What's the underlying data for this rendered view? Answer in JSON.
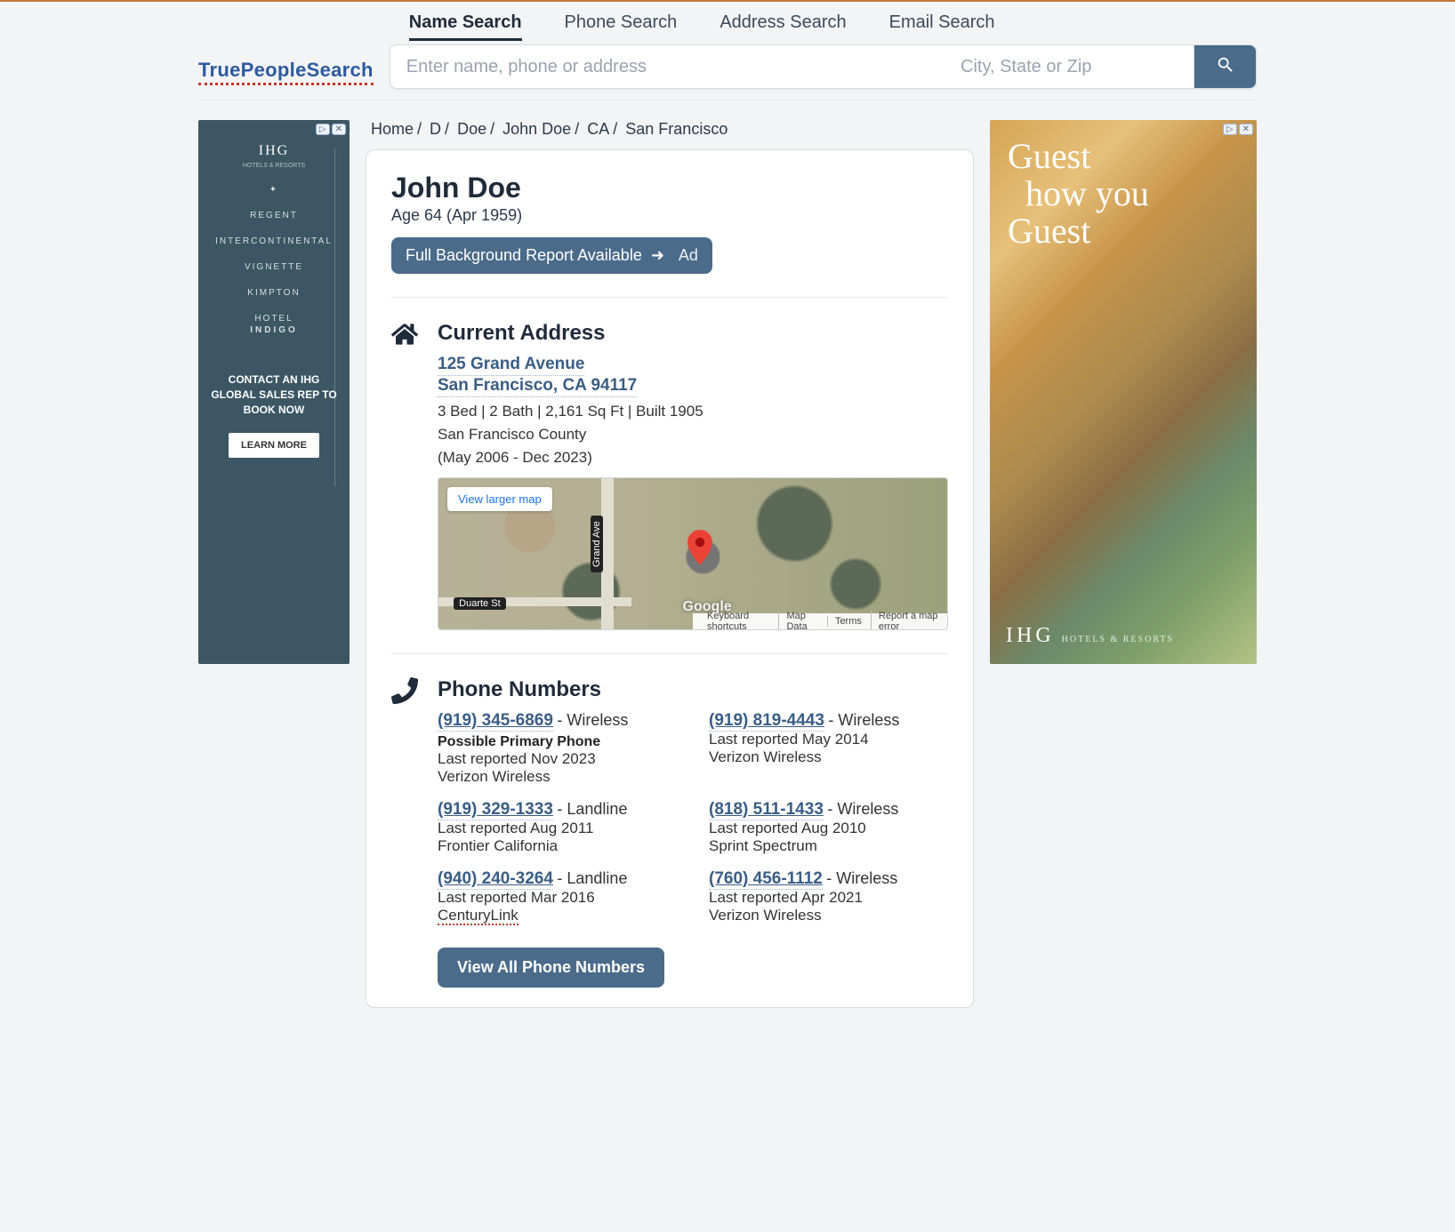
{
  "logo": {
    "part1": "True",
    "part2": "PeopleSearch"
  },
  "tabs": [
    "Name Search",
    "Phone Search",
    "Address Search",
    "Email Search"
  ],
  "search": {
    "name_ph": "Enter name, phone or address",
    "loc_ph": "City, State or Zip"
  },
  "breadcrumbs": [
    "Home",
    "D",
    "Doe",
    "John Doe",
    "CA",
    "San Francisco"
  ],
  "person": {
    "name": "John Doe",
    "age_line": "Age 64 (Apr 1959)"
  },
  "bg_button": {
    "label": "Full Background Report Available",
    "ad": "Ad"
  },
  "address": {
    "title": "Current Address",
    "line1": "125 Grand Avenue",
    "line2": "San Francisco, CA 94117",
    "specs": "3 Bed | 2 Bath | 2,161 Sq Ft | Built 1905",
    "county": "San Francisco County",
    "dates": "(May 2006 - Dec 2023)"
  },
  "map": {
    "view_larger": "View larger map",
    "road_v": "Grand Ave",
    "road_h": "Duarte St",
    "google": "Google",
    "controls": [
      "Keyboard shortcuts",
      "Map Data",
      "Terms",
      "Report a map error"
    ]
  },
  "phones": {
    "title": "Phone Numbers",
    "view_all": "View All Phone Numbers",
    "list": [
      {
        "number": "(919) 345-6869",
        "type": "Wireless",
        "primary": "Possible Primary Phone",
        "reported": "Last reported Nov 2023",
        "carrier": "Verizon Wireless"
      },
      {
        "number": "(919) 819-4443",
        "type": "Wireless",
        "reported": "Last reported May 2014",
        "carrier": "Verizon Wireless"
      },
      {
        "number": "(919) 329-1333",
        "type": "Landline",
        "reported": "Last reported Aug 2011",
        "carrier": "Frontier California"
      },
      {
        "number": "(818) 511-1433",
        "type": "Wireless",
        "reported": "Last reported Aug 2010",
        "carrier": "Sprint Spectrum"
      },
      {
        "number": "(940) 240-3264",
        "type": "Landline",
        "reported": "Last reported Mar 2016",
        "carrier": "CenturyLink"
      },
      {
        "number": "(760) 456-1112",
        "type": "Wireless",
        "reported": "Last reported Apr 2021",
        "carrier": "Verizon Wireless"
      }
    ]
  },
  "ads": {
    "left": {
      "brand": "IHG",
      "items": [
        "REGENT",
        "INTERCONTINENTAL",
        "VIGNETTE",
        "KIMPTON",
        "HOTEL",
        "INDIGO"
      ],
      "cta": "CONTACT AN IHG GLOBAL SALES REP TO BOOK NOW",
      "learn": "LEARN MORE"
    },
    "right": {
      "line1": "Guest",
      "line2": "how you",
      "line3": "Guest",
      "brand": "IHG",
      "tag": "HOTELS & RESORTS"
    }
  }
}
